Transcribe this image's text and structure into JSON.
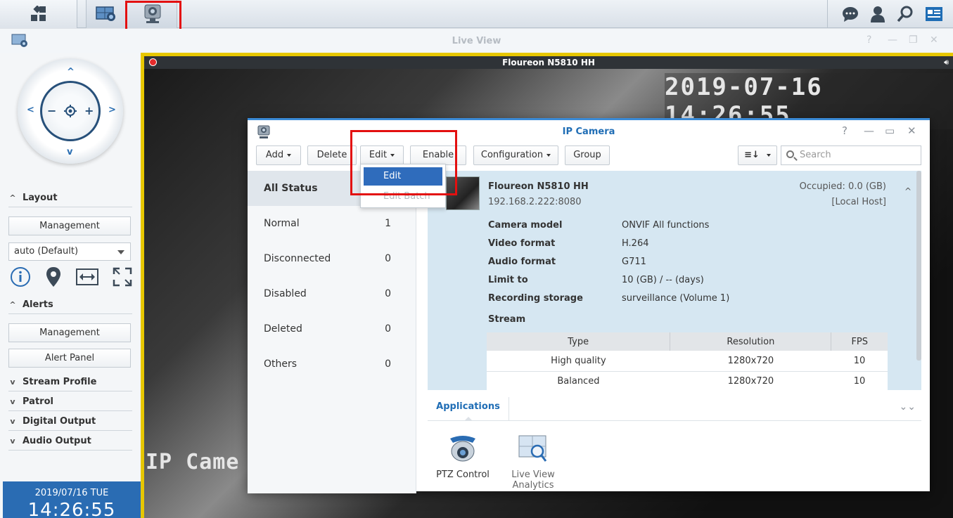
{
  "liveview": {
    "title": "Live View"
  },
  "left": {
    "layout": "Layout",
    "layout_management": "Management",
    "layout_select": "auto (Default)",
    "alerts": "Alerts",
    "alerts_management": "Management",
    "alert_panel": "Alert Panel",
    "stream_profile": "Stream Profile",
    "patrol": "Patrol",
    "digital_output": "Digital Output",
    "audio_output": "Audio Output",
    "date": "2019/07/16  TUE",
    "time": "14:26:55"
  },
  "video": {
    "title": "Floureon N5810 HH",
    "timestamp": "2019-07-16 14:26:55",
    "overlay": "IP Came"
  },
  "win": {
    "title": "IP Camera",
    "toolbar": {
      "add": "Add",
      "delete": "Delete",
      "edit": "Edit",
      "enable": "Enable",
      "configuration": "Configuration",
      "group": "Group",
      "search_placeholder": "Search"
    },
    "edit_menu": {
      "edit": "Edit",
      "edit_batch": "Edit Batch"
    },
    "status": [
      {
        "label": "All Status",
        "count": ""
      },
      {
        "label": "Normal",
        "count": "1"
      },
      {
        "label": "Disconnected",
        "count": "0"
      },
      {
        "label": "Disabled",
        "count": "0"
      },
      {
        "label": "Deleted",
        "count": "0"
      },
      {
        "label": "Others",
        "count": "0"
      }
    ],
    "camera": {
      "name": "Floureon N5810 HH",
      "ip": "192.168.2.222:8080",
      "occupied": "Occupied: 0.0 (GB)",
      "host": "[Local Host]",
      "props": [
        {
          "k": "Camera model",
          "v": "ONVIF All functions"
        },
        {
          "k": "Video format",
          "v": "H.264"
        },
        {
          "k": "Audio format",
          "v": "G711"
        },
        {
          "k": "Limit to",
          "v": "10 (GB) / -- (days)"
        },
        {
          "k": "Recording storage",
          "v": "surveillance (Volume 1)"
        }
      ],
      "stream_label": "Stream",
      "stream_headers": [
        "Type",
        "Resolution",
        "FPS"
      ],
      "stream_rows": [
        [
          "High quality",
          "1280x720",
          "10"
        ],
        [
          "Balanced",
          "1280x720",
          "10"
        ]
      ]
    },
    "apps_tab": "Applications",
    "apps": [
      {
        "line1": "PTZ Control",
        "line2": ""
      },
      {
        "line1": "Live View",
        "line2": "Analytics"
      }
    ]
  }
}
